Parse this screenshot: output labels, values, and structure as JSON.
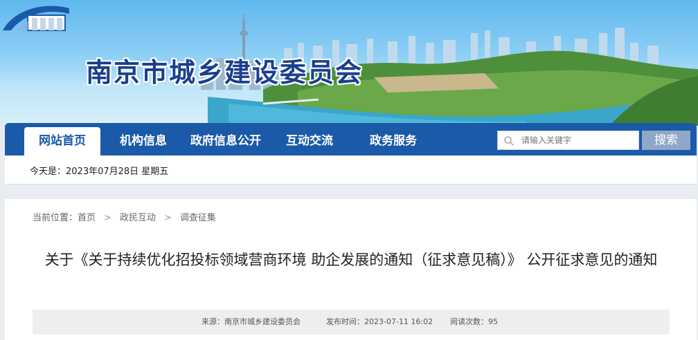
{
  "site": {
    "title": "南京市城乡建设委员会"
  },
  "nav": {
    "items": [
      {
        "label": "网站首页",
        "active": true
      },
      {
        "label": "机构信息",
        "active": false
      },
      {
        "label": "政府信息公开",
        "active": false
      },
      {
        "label": "互动交流",
        "active": false
      },
      {
        "label": "政务服务",
        "active": false
      }
    ]
  },
  "search": {
    "placeholder": "请输入关键字",
    "button_label": "搜索",
    "icon": "search-icon"
  },
  "date_bar": {
    "text": "今天是：2023年07月28日 星期五"
  },
  "breadcrumb": {
    "prefix": "当前位置：",
    "items": [
      "首页",
      "政民互动",
      "调查征集"
    ],
    "separator": ">"
  },
  "article": {
    "title": "关于《关于持续优化招投标领域营商环境 助企发展的通知（征求意见稿）》 公开征求意见的通知",
    "source": "来源：南京市城乡建设委员会",
    "published": "发布时间：2023-07-11 16:02",
    "reads": "阅读次数：95"
  },
  "colors": {
    "nav_bg": "#1a5aa8",
    "title_blue": "#1a3f8f",
    "search_btn": "#8fa7c8"
  }
}
